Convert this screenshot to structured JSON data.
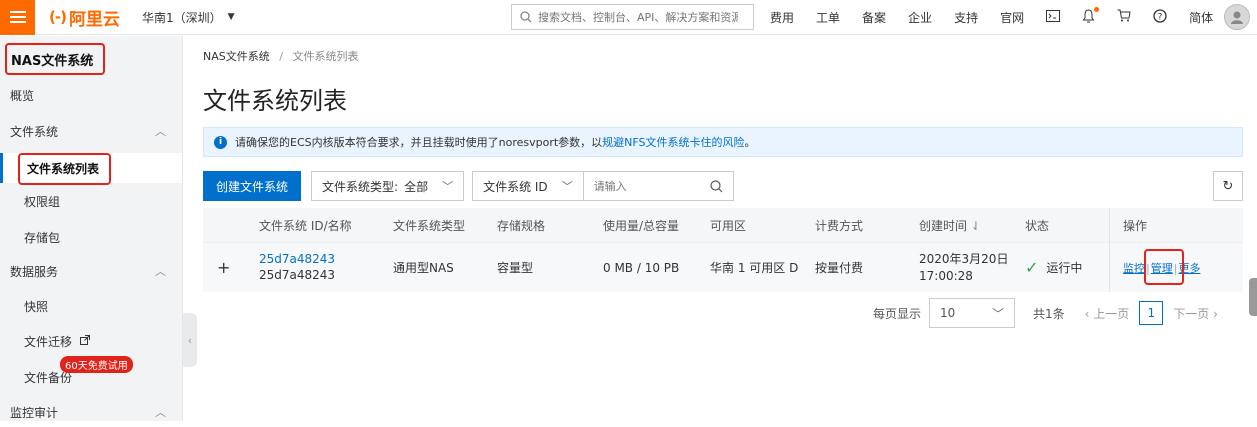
{
  "topbar": {
    "logo_mark": "(-)",
    "logo_text": "阿里云",
    "region": "华南1（深圳）",
    "region_caret": "▼",
    "search_placeholder": "搜索文档、控制台、API、解决方案和资源",
    "nav": [
      "费用",
      "工单",
      "备案",
      "企业",
      "支持",
      "官网"
    ],
    "lang": "简体"
  },
  "sidebar": {
    "title": "NAS文件系统",
    "items": [
      {
        "label": "概览"
      },
      {
        "label": "文件系统",
        "chevron": "︿"
      },
      {
        "label": "文件系统列表"
      },
      {
        "label": "权限组"
      },
      {
        "label": "存储包"
      },
      {
        "label": "数据服务",
        "chevron": "︿"
      },
      {
        "label": "快照"
      },
      {
        "label": "文件迁移"
      },
      {
        "label": "文件备份"
      },
      {
        "label": "监控审计",
        "chevron": "︿"
      }
    ],
    "badge": "60天免费试用"
  },
  "breadcrumb": {
    "root": "NAS文件系统",
    "sep": "/",
    "current": "文件系统列表"
  },
  "page_title": "文件系统列表",
  "notice": {
    "text": "请确保您的ECS内核版本符合要求，并且挂载时使用了noresvport参数，以",
    "link": "规避NFS文件系统卡住的风险",
    "tail": "。"
  },
  "toolbar": {
    "create_label": "创建文件系统",
    "type_filter_label": "文件系统类型:",
    "type_filter_value": "全部",
    "id_filter_label": "文件系统 ID",
    "search_placeholder": "请输入"
  },
  "table": {
    "headers": [
      "文件系统 ID/名称",
      "文件系统类型",
      "存储规格",
      "使用量/总容量",
      "可用区",
      "计费方式",
      "创建时间",
      "状态",
      "操作"
    ],
    "sort_icon": "⇃",
    "rows": [
      {
        "expand": "+",
        "id": "25d7a48243",
        "name": "25d7a48243",
        "type": "通用型NAS",
        "spec": "容量型",
        "usage": "0 MB / 10 PB",
        "zone": "华南 1 可用区 D",
        "billing": "按量付费",
        "created_date": "2020年3月20日",
        "created_time": "17:00:28",
        "status": "运行中",
        "ops": {
          "monitor": "监控",
          "manage": "管理",
          "more": "更多",
          "sep": "|"
        }
      }
    ]
  },
  "pager": {
    "per_page_label": "每页显示",
    "per_page_value": "10",
    "total": "共1条",
    "prev": "上一页",
    "current": "1",
    "next": "下一页"
  }
}
